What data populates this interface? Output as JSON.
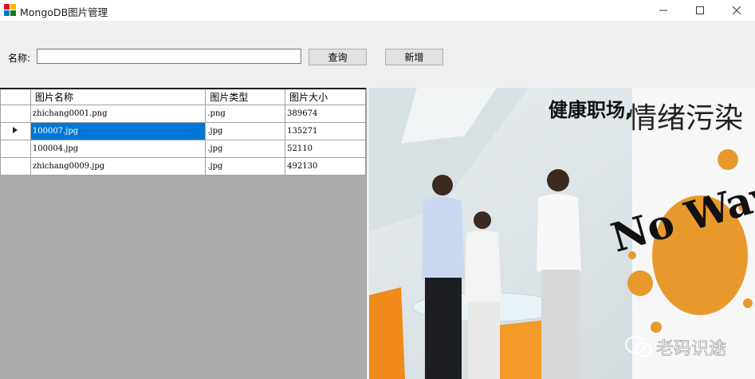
{
  "window": {
    "title": "MongoDB图片管理"
  },
  "search": {
    "label": "名称:",
    "value": "",
    "query_label": "查询",
    "add_label": "新增"
  },
  "grid": {
    "columns": [
      "图片名称",
      "图片类型",
      "图片大小"
    ],
    "rows": [
      {
        "name": "zhichang0001.png",
        "type": ".png",
        "size": "389674",
        "selected": false
      },
      {
        "name": "100007.jpg",
        "type": ".jpg",
        "size": "135271",
        "selected": true
      },
      {
        "name": "100004.jpg",
        "type": ".jpg",
        "size": "52110",
        "selected": false
      },
      {
        "name": "zhichang0009.jpg",
        "type": ".jpg",
        "size": "492130",
        "selected": false
      }
    ]
  },
  "picture": {
    "headline_a": "健康职场,",
    "headline_b": "情绪污染",
    "slogan": "No Way",
    "watermark": "老码识途",
    "splash_color": "#e79a2b"
  },
  "colors": {
    "selection": "#0078d7",
    "grid_empty": "#ababab"
  }
}
